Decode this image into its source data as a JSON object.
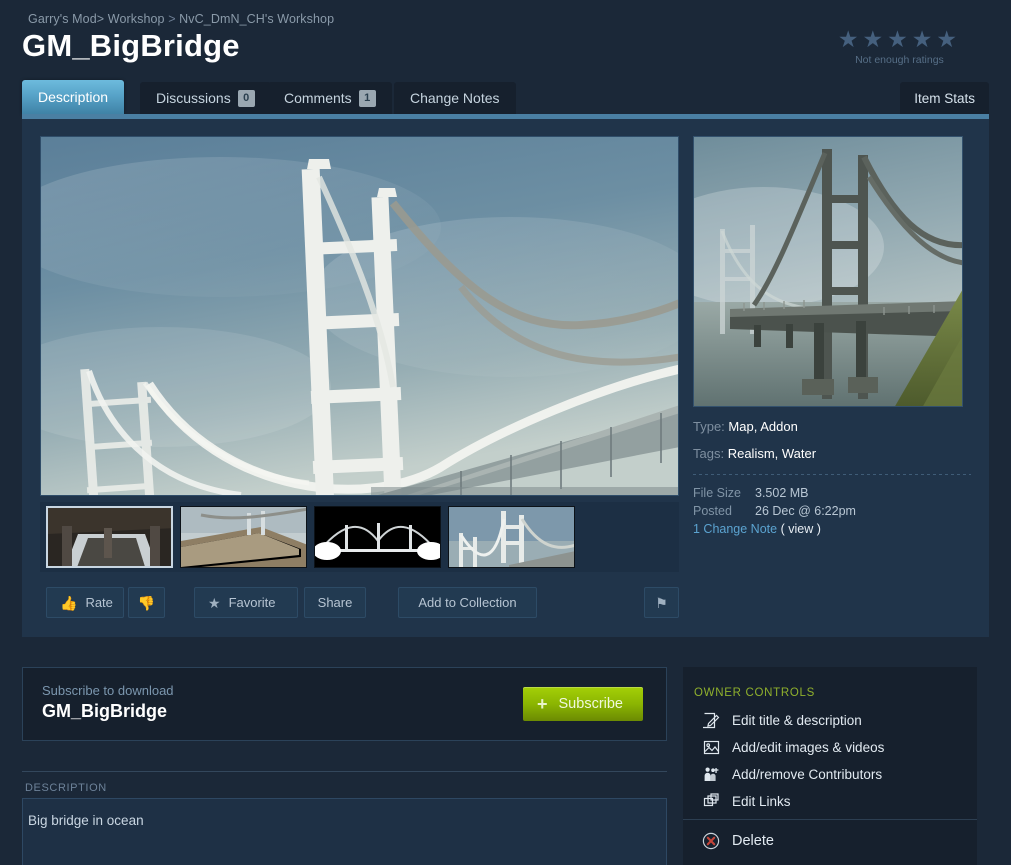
{
  "breadcrumb": {
    "game": "Garry's Mod>",
    "workshop": "Workshop",
    "separator": ">",
    "user_workshop": "NvC_DmN_CH's Workshop"
  },
  "page_title": "GM_BigBridge",
  "rating": {
    "stars_filled": 0,
    "stars_total": 5,
    "caption": "Not enough ratings"
  },
  "tabs": [
    {
      "label": "Description",
      "badge": "",
      "active": true
    },
    {
      "label": "Discussions",
      "badge": "0",
      "active": false
    },
    {
      "label": "Comments",
      "badge": "1",
      "active": false
    },
    {
      "label": "Change Notes",
      "badge": "",
      "active": false
    }
  ],
  "item_stats_label": "Item Stats",
  "actions": [
    {
      "name": "rate",
      "icon": "thumbs-up-icon",
      "label": "Rate"
    },
    {
      "name": "thumbs-down",
      "icon": "thumbs-down-icon",
      "label": ""
    },
    {
      "name": "favorite",
      "icon": "star-icon",
      "label": "Favorite"
    },
    {
      "name": "share",
      "icon": "",
      "label": "Share"
    },
    {
      "name": "add-to-collection",
      "icon": "",
      "label": "Add to Collection"
    },
    {
      "name": "report",
      "icon": "flag-icon",
      "label": ""
    }
  ],
  "info": {
    "type_label": "Type:",
    "type_values": "Map, Addon",
    "tags_label": "Tags:",
    "tags_values": "Realism, Water",
    "file_size_label": "File Size",
    "file_size_value": "3.502 MB",
    "posted_label": "Posted",
    "posted_value": "26 Dec @ 6:22pm",
    "change_note_link": "1 Change Note",
    "change_note_view": "( view )"
  },
  "subscribe": {
    "small_label": "Subscribe to download",
    "title": "GM_BigBridge",
    "button_plus": "+",
    "button_label": "Subscribe"
  },
  "description": {
    "heading": "DESCRIPTION",
    "body": "Big bridge in ocean"
  },
  "owner_controls": {
    "heading": "OWNER CONTROLS",
    "items": [
      {
        "icon": "pencil-edit-icon",
        "label": "Edit title & description"
      },
      {
        "icon": "image-icon",
        "label": "Add/edit images & videos"
      },
      {
        "icon": "contributors-icon",
        "label": "Add/remove Contributors"
      },
      {
        "icon": "links-icon",
        "label": "Edit Links"
      }
    ],
    "delete": {
      "icon": "delete-circle-x-icon",
      "label": "Delete"
    }
  },
  "colors": {
    "page_bg": "#1b2838",
    "panel_bg": "#20344a",
    "dark_panel_bg": "#16202d",
    "accent_blue": "#4a7fa3",
    "active_tab": "#57a3c8",
    "link_blue": "#5ba3d0",
    "subscribe_green": "#8bb502",
    "owner_heading_green": "#8fb02d",
    "delete_red": "#c4453a"
  },
  "media": {
    "hero_alt": "suspension bridge towers against blue sky",
    "preview_alt": "bridge over water with green hillside",
    "thumbnails": [
      {
        "alt": "under-bridge roadway view",
        "selected": true
      },
      {
        "alt": "bridge deck in fog",
        "selected": false
      },
      {
        "alt": "bridge silhouette on black",
        "selected": false
      },
      {
        "alt": "bridge tower and cables",
        "selected": false
      }
    ]
  }
}
